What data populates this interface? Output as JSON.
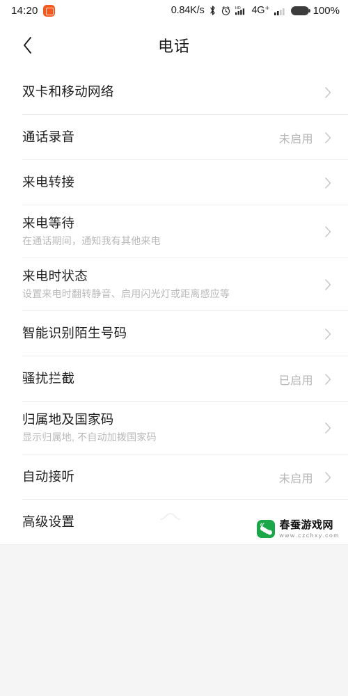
{
  "status_bar": {
    "time": "14:20",
    "app_icon": "alarm-app-icon",
    "network_speed": "0.84K/s",
    "bluetooth_icon": "bluetooth-icon",
    "alarm_icon": "alarm-clock-icon",
    "hd_signal_icon": "hd-volte-signal-icon",
    "network_type": "4G⁺",
    "signal_icon": "signal-bars-icon",
    "battery_icon": "battery-full-icon",
    "battery_percent": "100%"
  },
  "header": {
    "back_icon": "chevron-left-icon",
    "title": "电话"
  },
  "list": {
    "chevron_icon": "chevron-right-icon",
    "items": [
      {
        "title": "双卡和移动网络",
        "subtitle": "",
        "value": ""
      },
      {
        "title": "通话录音",
        "subtitle": "",
        "value": "未启用"
      },
      {
        "title": "来电转接",
        "subtitle": "",
        "value": ""
      },
      {
        "title": "来电等待",
        "subtitle": "在通话期间，通知我有其他来电",
        "value": ""
      },
      {
        "title": "来电时状态",
        "subtitle": "设置来电时翻转静音、启用闪光灯或距离感应等",
        "value": ""
      },
      {
        "title": "智能识别陌生号码",
        "subtitle": "",
        "value": ""
      },
      {
        "title": "骚扰拦截",
        "subtitle": "",
        "value": "已启用"
      },
      {
        "title": "归属地及国家码",
        "subtitle": "显示归属地, 不自动加拨国家码",
        "value": ""
      },
      {
        "title": "自动接听",
        "subtitle": "",
        "value": "未启用"
      },
      {
        "title": "高级设置",
        "subtitle": "",
        "value": ""
      }
    ]
  },
  "watermark": {
    "logo_icon": "silkworm-logo-icon",
    "name": "春蚕游戏网",
    "url": "www.czchxy.com"
  },
  "colors": {
    "card_bg": "#ffffff",
    "page_bg": "#f5f5f5",
    "title_text": "#1f1f1f",
    "sub_text": "#b9b9b9",
    "value_text": "#b5b5b5",
    "divider": "#ececec",
    "accent_orange": "#f4591f",
    "watermark_green": "#19a749"
  }
}
